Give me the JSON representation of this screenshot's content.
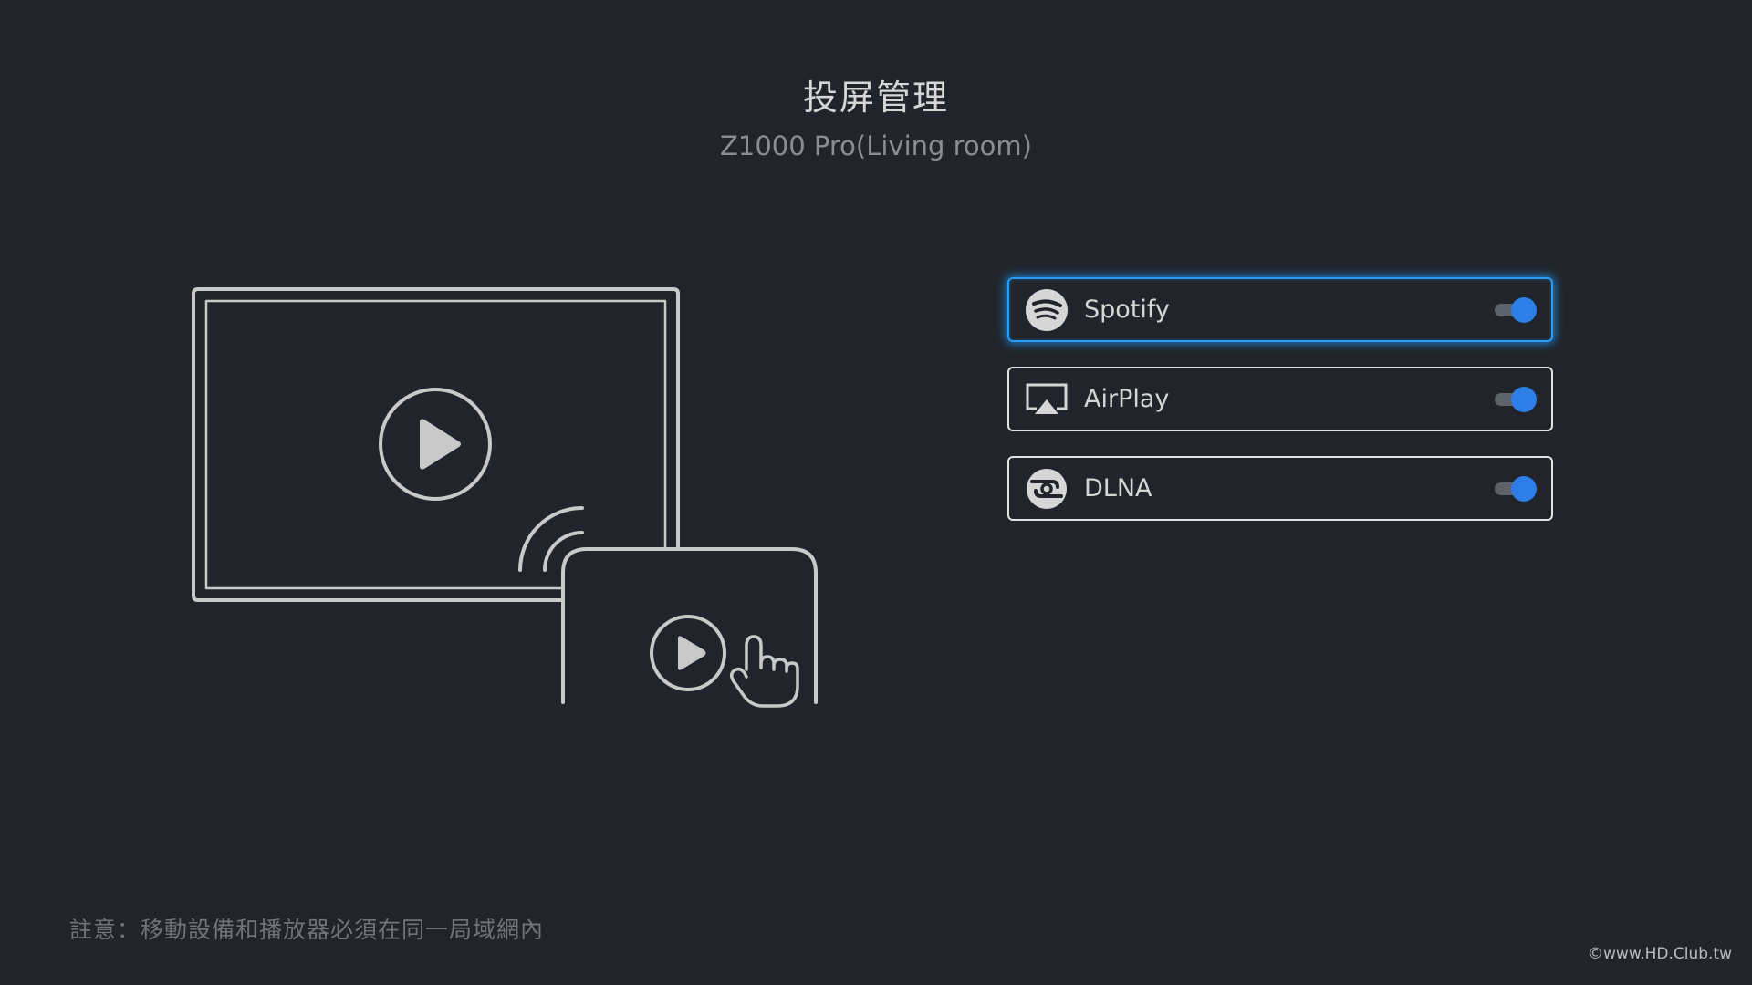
{
  "header": {
    "title": "投屏管理",
    "subtitle": "Z1000 Pro(Living room)"
  },
  "services": [
    {
      "label": "Spotify",
      "icon": "spotify-icon",
      "enabled": true,
      "focused": true
    },
    {
      "label": "AirPlay",
      "icon": "airplay-icon",
      "enabled": true,
      "focused": false
    },
    {
      "label": "DLNA",
      "icon": "dlna-icon",
      "enabled": true,
      "focused": false
    }
  ],
  "footer": {
    "note": "註意：移動設備和播放器必須在同一局域網內",
    "watermark": "©www.HD.Club.tw"
  },
  "colors": {
    "background": "#21252b",
    "accent": "#2d7ee6",
    "focus_glow": "#2a9cf5"
  }
}
